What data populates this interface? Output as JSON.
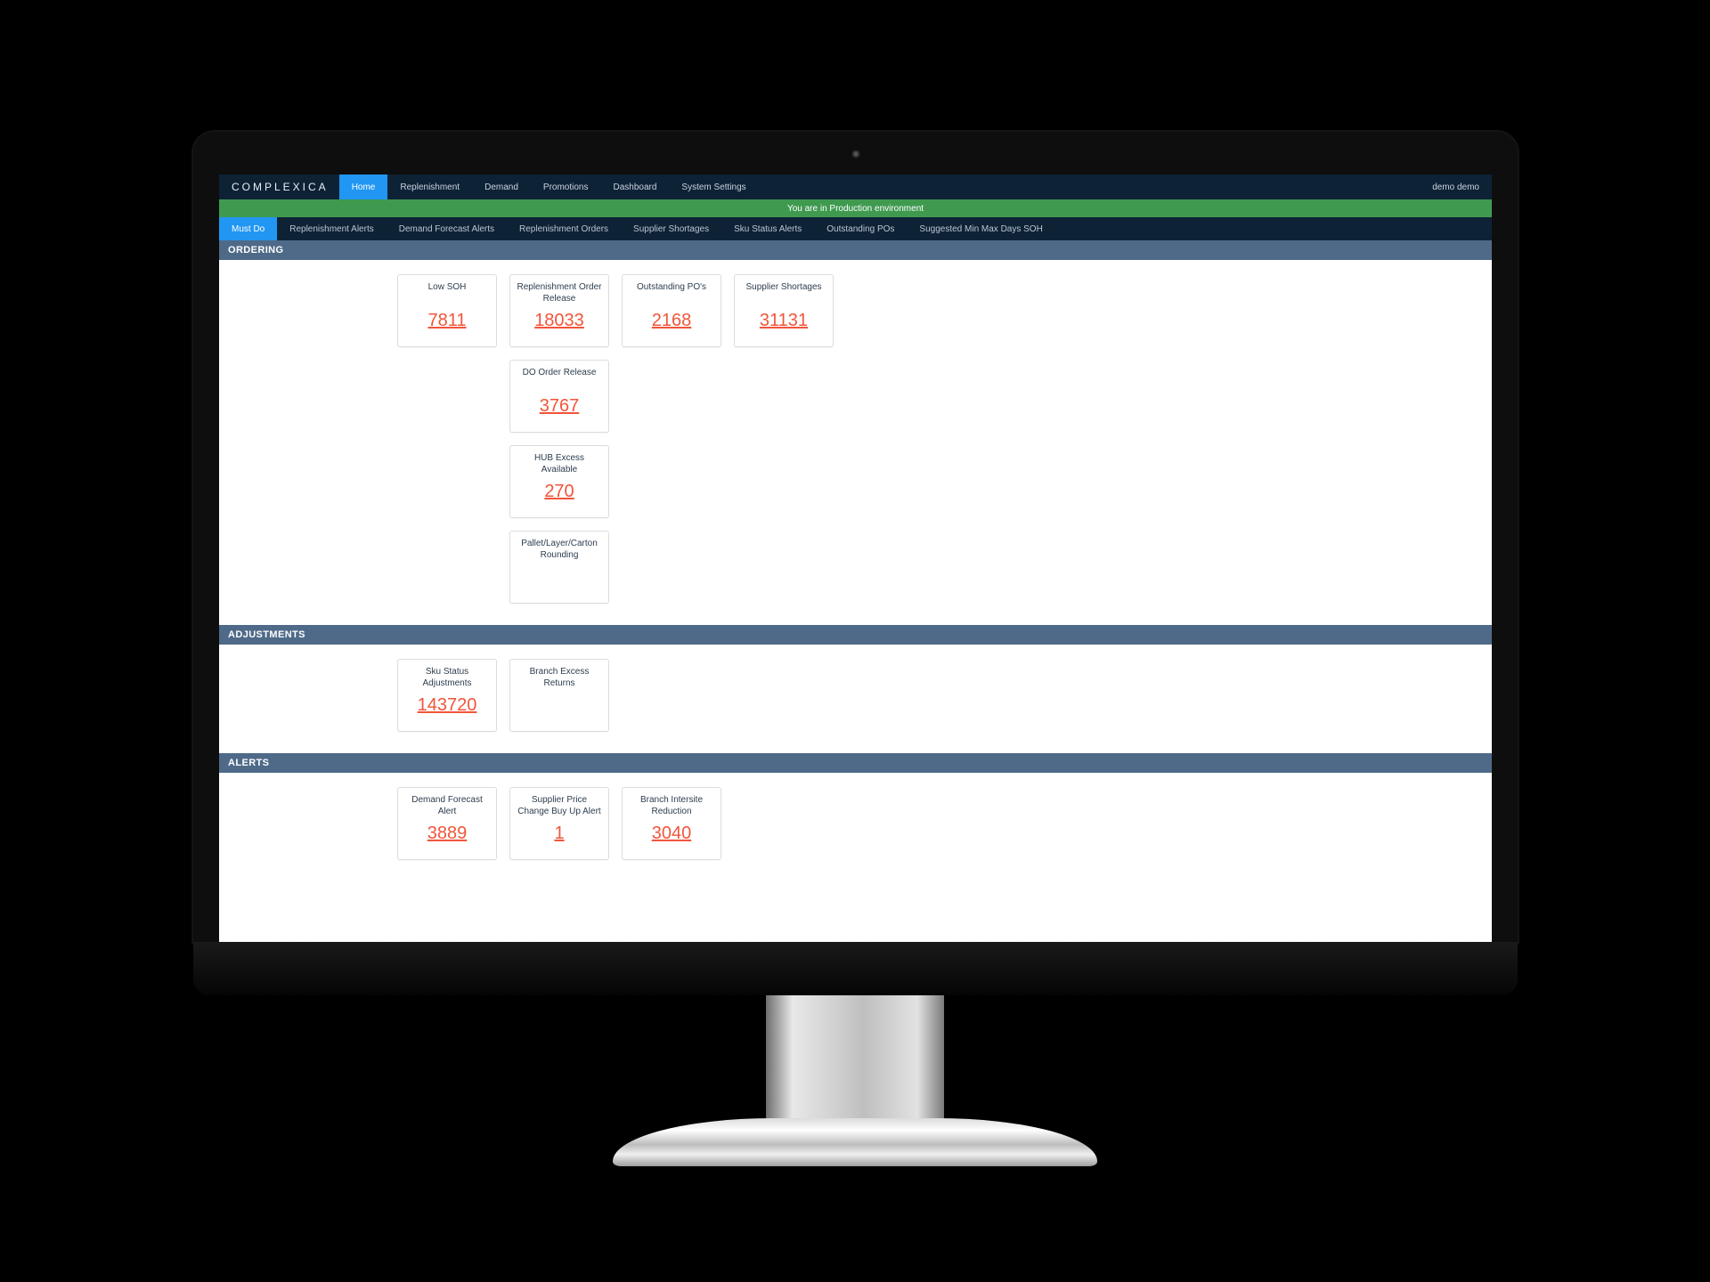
{
  "brand": "COMPLEXICA",
  "user_label": "demo demo",
  "nav": [
    {
      "label": "Home",
      "active": true
    },
    {
      "label": "Replenishment"
    },
    {
      "label": "Demand"
    },
    {
      "label": "Promotions"
    },
    {
      "label": "Dashboard"
    },
    {
      "label": "System Settings"
    }
  ],
  "env_banner": "You are in Production environment",
  "subtabs": [
    {
      "label": "Must Do",
      "active": true
    },
    {
      "label": "Replenishment Alerts"
    },
    {
      "label": "Demand Forecast Alerts"
    },
    {
      "label": "Replenishment Orders"
    },
    {
      "label": "Supplier Shortages"
    },
    {
      "label": "Sku Status Alerts"
    },
    {
      "label": "Outstanding POs"
    },
    {
      "label": "Suggested Min Max Days SOH"
    }
  ],
  "sections": {
    "ordering": {
      "title": "ORDERING",
      "col1": [
        {
          "label": "Low SOH",
          "value": "7811"
        }
      ],
      "col2": [
        {
          "label": "Replenishment Order Release",
          "value": "18033"
        },
        {
          "label": "DO Order Release",
          "value": "3767"
        },
        {
          "label": "HUB Excess Available",
          "value": "270"
        },
        {
          "label": "Pallet/Layer/Carton Rounding",
          "value": ""
        }
      ],
      "col3": [
        {
          "label": "Outstanding PO's",
          "value": "2168"
        }
      ],
      "col4": [
        {
          "label": "Supplier Shortages",
          "value": "31131"
        }
      ]
    },
    "adjustments": {
      "title": "ADJUSTMENTS",
      "cards": [
        {
          "label": "Sku Status Adjustments",
          "value": "143720"
        },
        {
          "label": "Branch Excess Returns",
          "value": ""
        }
      ]
    },
    "alerts": {
      "title": "ALERTS",
      "cards": [
        {
          "label": "Demand Forecast Alert",
          "value": "3889"
        },
        {
          "label": "Supplier Price Change Buy Up Alert",
          "value": "1"
        },
        {
          "label": "Branch Intersite Reduction",
          "value": "3040"
        }
      ]
    }
  }
}
